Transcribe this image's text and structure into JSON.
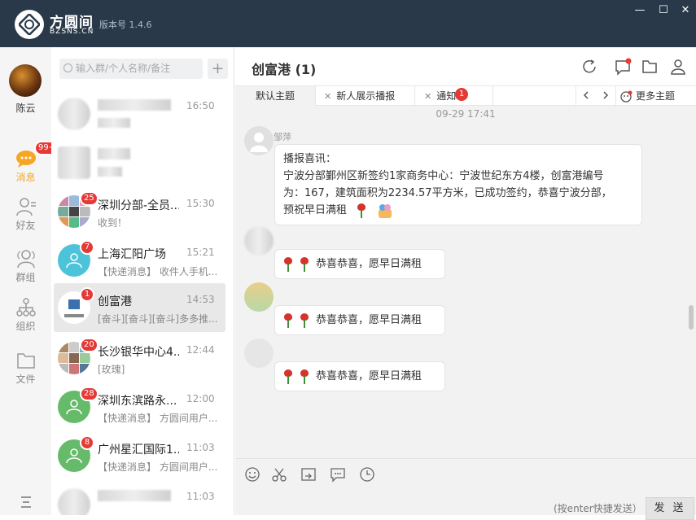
{
  "app": {
    "logo_text": "方圆间",
    "logo_sub": "BZSNS.CN",
    "version": "版本号 1.4.6"
  },
  "window": {
    "minimize": "—",
    "maximize": "☐",
    "close": "✕"
  },
  "user": {
    "name": "陈云"
  },
  "nav": {
    "items": [
      {
        "label": "消息",
        "icon": "message-icon",
        "badge": "99+"
      },
      {
        "label": "好友",
        "icon": "friends-icon"
      },
      {
        "label": "群组",
        "icon": "group-icon"
      },
      {
        "label": "组织",
        "icon": "org-icon"
      },
      {
        "label": "文件",
        "icon": "folder-icon"
      }
    ],
    "menu_icon": "menu-icon"
  },
  "search": {
    "placeholder": "输入群/个人名称/备注",
    "add": "+"
  },
  "conversations": [
    {
      "title": "",
      "time": "16:50",
      "preview": "",
      "badge": ""
    },
    {
      "title": "",
      "time": "",
      "preview": "",
      "badge": ""
    },
    {
      "title": "深圳分部-全员...",
      "time": "15:30",
      "preview": "收到！",
      "badge": "25"
    },
    {
      "title": "上海汇阳广场",
      "time": "15:21",
      "preview": "【快递消息】 收件人手机...",
      "badge": "7"
    },
    {
      "title": "创富港",
      "time": "14:53",
      "preview": "[奋斗][奋斗][奋斗]多多推...",
      "badge": "1"
    },
    {
      "title": "长沙银华中心4...",
      "time": "12:44",
      "preview": "[玫瑰]",
      "badge": "20"
    },
    {
      "title": "深圳东滨路永...",
      "time": "12:00",
      "preview": "【快递消息】 方圆间用户...",
      "badge": "28"
    },
    {
      "title": "广州星汇国际1...",
      "time": "11:03",
      "preview": "【快递消息】 方圆间用户...",
      "badge": "8"
    },
    {
      "title": "",
      "time": "11:03",
      "preview": "",
      "badge": ""
    }
  ],
  "chat": {
    "title": "创富港 (1)",
    "tabs": [
      {
        "label": "默认主题"
      },
      {
        "label": "新人展示播报"
      },
      {
        "label": "通知",
        "badge": "1"
      }
    ],
    "more_topics": "更多主题",
    "timestamp": "09-29 17:41",
    "messages": [
      {
        "sender": "邹萍",
        "lines": [
          "播报喜讯：",
          "宁波分部鄞州区新签约1家商务中心：宁波世纪东方4楼，创富港编号",
          "为：167，建筑面积为2234.57平方米，已成功签约，恭喜宁波分部，",
          "预祝早日满租"
        ]
      },
      {
        "sender": "",
        "text": "恭喜恭喜，愿早日满租"
      },
      {
        "sender": "",
        "text": "恭喜恭喜，愿早日满租"
      },
      {
        "sender": "",
        "text": "恭喜恭喜，愿早日满租"
      }
    ],
    "hint": "(按enter快捷发送）",
    "send": "发 送"
  }
}
